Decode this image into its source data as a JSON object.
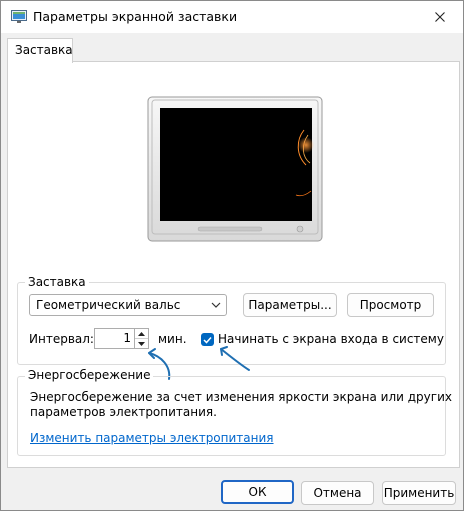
{
  "window": {
    "title": "Параметры экранной заставки"
  },
  "tabs": [
    {
      "label": "Заставка"
    }
  ],
  "screensaver": {
    "group_label": "Заставка",
    "selected": "Геометрический вальс",
    "settings_button": "Параметры...",
    "preview_button": "Просмотр",
    "interval_label": "Интервал:",
    "interval_value": "1",
    "interval_unit": "мин.",
    "logon_checkbox_label": "Начинать с экрана входа в систему",
    "logon_checked": true
  },
  "power": {
    "group_label": "Энергосбережение",
    "description_line1": "Энергосбережение за счет изменения яркости экрана или других",
    "description_line2": "параметров электропитания.",
    "link": "Изменить параметры электропитания"
  },
  "footer": {
    "ok": "ОК",
    "cancel": "Отмена",
    "apply": "Применить"
  },
  "colors": {
    "accent": "#0067c0",
    "link": "#0066cc",
    "annotation": "#1f6fb2"
  }
}
